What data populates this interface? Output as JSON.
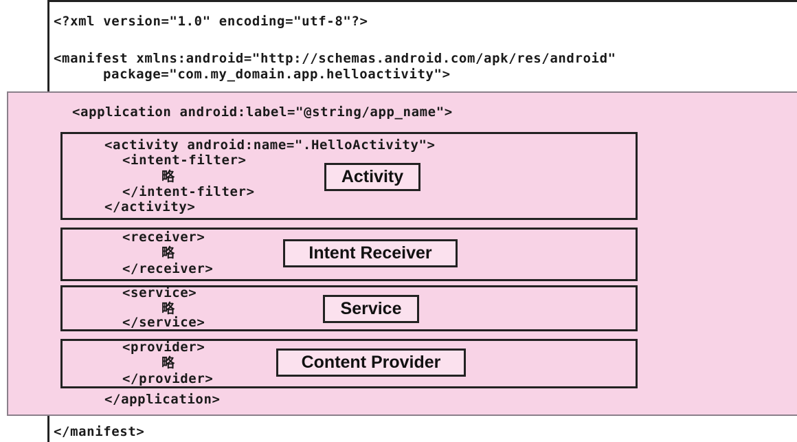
{
  "xml_declaration": "<?xml version=\"1.0\" encoding=\"utf-8\"?>",
  "manifest_open_1": "<manifest xmlns:android=\"http://schemas.android.com/apk/res/android\"",
  "manifest_open_2": "package=\"com.my_domain.app.helloactivity\">",
  "application_open": "<application android:label=\"@string/app_name\">",
  "activity": {
    "open": "<activity android:name=\".HelloActivity\">",
    "filter_open": "<intent-filter>",
    "omitted": "略",
    "filter_close": "</intent-filter>",
    "close": "</activity>",
    "label": "Activity"
  },
  "receiver": {
    "open": "<receiver>",
    "omitted": "略",
    "close": "</receiver>",
    "label": "Intent Receiver"
  },
  "service": {
    "open": "<service>",
    "omitted": "略",
    "close": "</service>",
    "label": "Service"
  },
  "provider": {
    "open": "<provider>",
    "omitted": "略",
    "close": "</provider>",
    "label": "Content Provider"
  },
  "application_close": "</application>",
  "manifest_close": "</manifest>"
}
